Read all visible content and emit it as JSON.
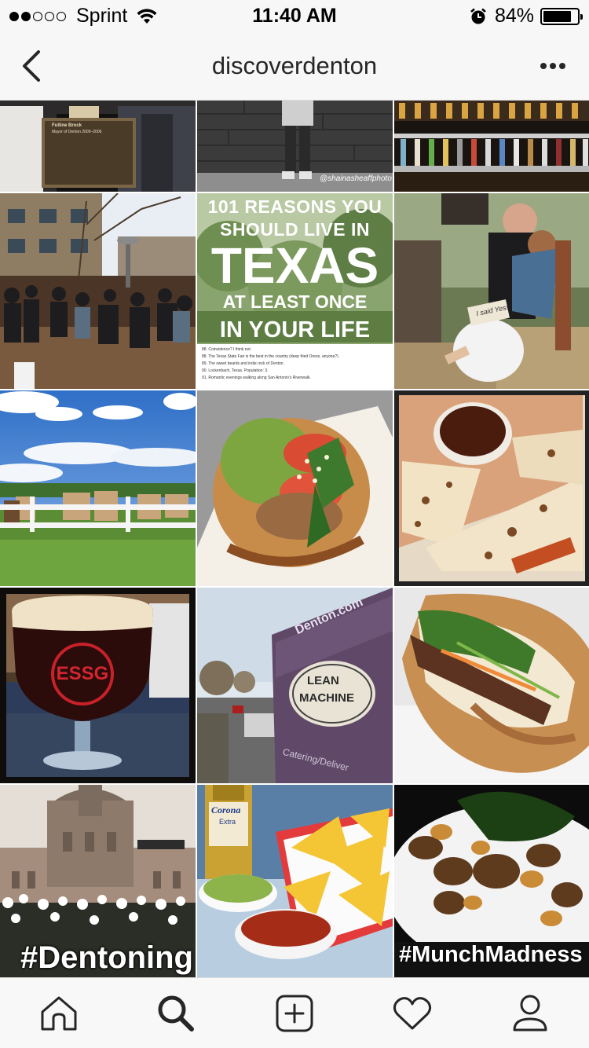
{
  "status_bar": {
    "carrier": "Sprint",
    "time": "11:40 AM",
    "battery_percent": "84%",
    "battery_level": 0.84,
    "signal_bars_filled": 2,
    "signal_bars_total": 5
  },
  "header": {
    "title": "discoverdenton",
    "back_icon": "chevron-left-icon",
    "more_icon": "more-horizontal-icon"
  },
  "posts": {
    "watermark": "@shainasheaffphoto",
    "plaque_title": "Fulline Brock",
    "plaque_subtitle": "Mayor of Denton 2000–2006",
    "texas_lines": [
      "101 REASONS YOU",
      "SHOULD LIVE IN",
      "TEXAS",
      "AT LEAST ONCE",
      "IN YOUR LIFE"
    ],
    "texas_list": [
      "88. Coincidence? I think not.",
      "88. The Texas State Fair is the best in the country (deep fried Oreos, anyone?)",
      "89. The sweet beards and indie rock of Denton.",
      "90. Lockenbach, Texas. Population: 3.",
      "91. Romantic evenings walking along San Antonio's Riverwalk."
    ],
    "sign_text": "I said Yes!",
    "glass_logo": "ESSG",
    "truck_url": "Denton.com",
    "truck_logo_line1": "LEAN",
    "truck_logo_line2": "MACHINE",
    "truck_side_text": "Catering/Deliver",
    "beer_label_1": "Corona",
    "beer_label_2": "Extra",
    "hashtag_1": "#Dentoning",
    "hashtag_2": "#MunchMadness"
  },
  "tab_bar": {
    "tabs": [
      {
        "name": "home",
        "icon": "home-icon",
        "active": false
      },
      {
        "name": "search",
        "icon": "search-icon",
        "active": true
      },
      {
        "name": "new-post",
        "icon": "plus-square-icon",
        "active": false
      },
      {
        "name": "activity",
        "icon": "heart-icon",
        "active": false
      },
      {
        "name": "profile",
        "icon": "person-icon",
        "active": false
      }
    ]
  },
  "colors": {
    "bar_background": "#f7f7f7",
    "divider": "#dbdbdb",
    "text": "#262626"
  }
}
